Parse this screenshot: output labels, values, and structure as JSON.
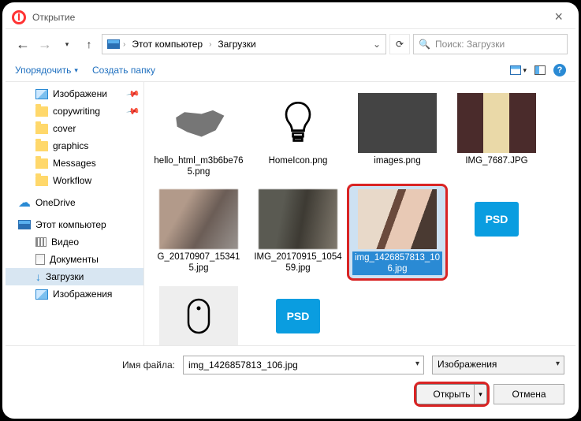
{
  "window": {
    "title": "Открытие"
  },
  "nav": {
    "crumbs": [
      "Этот компьютер",
      "Загрузки"
    ],
    "search_placeholder": "Поиск: Загрузки"
  },
  "toolbar": {
    "organize": "Упорядочить",
    "new_folder": "Создать папку"
  },
  "sidebar": {
    "items": [
      {
        "label": "Изображени",
        "icon": "pictures",
        "pinned": true,
        "indent": 1
      },
      {
        "label": "copywriting",
        "icon": "folder",
        "pinned": true,
        "indent": 1
      },
      {
        "label": "cover",
        "icon": "folder",
        "indent": 1
      },
      {
        "label": "graphics",
        "icon": "folder",
        "indent": 1
      },
      {
        "label": "Messages",
        "icon": "folder",
        "indent": 1
      },
      {
        "label": "Workflow",
        "icon": "folder",
        "indent": 1
      },
      {
        "label": "OneDrive",
        "icon": "onedrive",
        "indent": 0
      },
      {
        "label": "Этот компьютер",
        "icon": "pc",
        "indent": 0
      },
      {
        "label": "Видео",
        "icon": "videos",
        "indent": 1
      },
      {
        "label": "Документы",
        "icon": "documents",
        "indent": 1
      },
      {
        "label": "Загрузки",
        "icon": "downloads",
        "indent": 1,
        "selected": true
      },
      {
        "label": "Изображения",
        "icon": "pictures",
        "indent": 1
      }
    ]
  },
  "files": [
    {
      "name": "hello_html_m3b6be765.png",
      "thumb": "crimea"
    },
    {
      "name": "HomeIcon.png",
      "thumb": "bulb"
    },
    {
      "name": "images.png",
      "thumb": "icons"
    },
    {
      "name": "IMG_7687.JPG",
      "thumb": "brochure"
    },
    {
      "name": "G_20170907_153415.jpg",
      "thumb": "blur1"
    },
    {
      "name": "IMG_20170915_105459.jpg",
      "thumb": "blur2"
    },
    {
      "name": "img_1426857813_106.jpg",
      "thumb": "woman",
      "selected": true
    },
    {
      "name": "",
      "thumb": "psd"
    },
    {
      "name": "",
      "thumb": "mouse"
    },
    {
      "name": "",
      "thumb": "psd"
    }
  ],
  "bottom": {
    "filename_label": "Имя файла:",
    "filename_value": "img_1426857813_106.jpg",
    "filter_label": "Изображения",
    "open": "Открыть",
    "cancel": "Отмена"
  },
  "psd_label": "PSD"
}
